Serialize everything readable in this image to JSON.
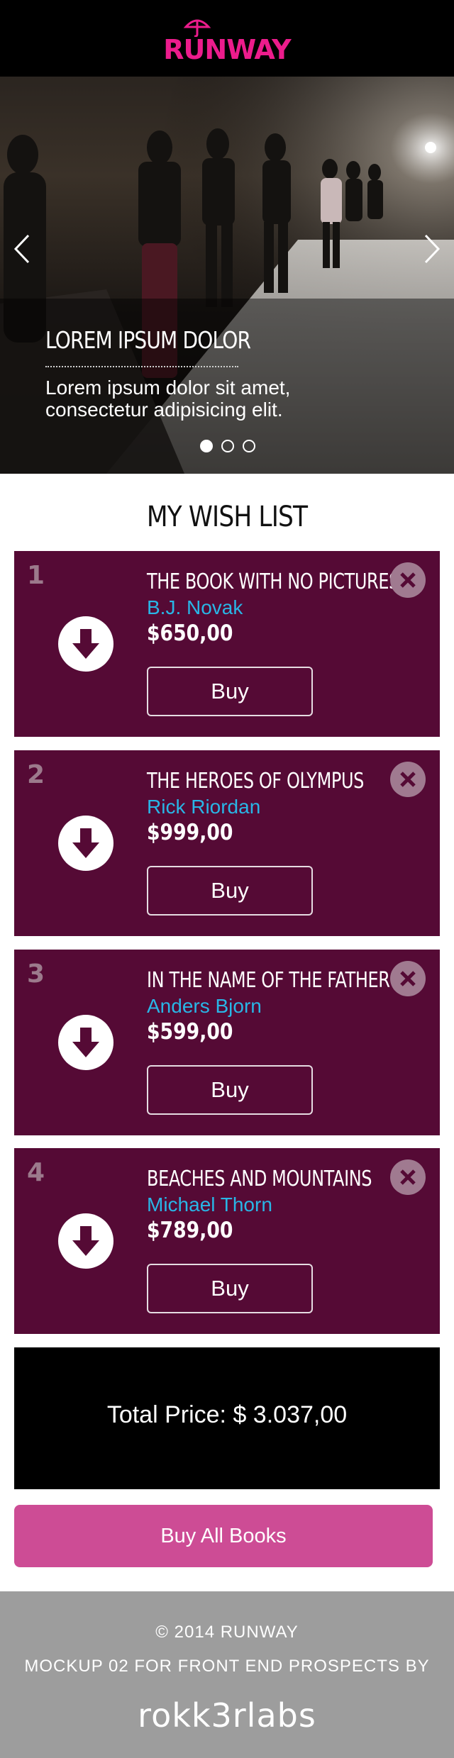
{
  "header": {
    "logo_text": "RUNWAY",
    "brand_color": "#ec1c8c"
  },
  "hero": {
    "title": "LOREM IPSUM DOLOR",
    "text": "Lorem ipsum dolor sit amet, consectetur adipisicing elit.",
    "slides_total": 3,
    "slide_active": 1
  },
  "wishlist": {
    "heading": "MY WISH LIST",
    "items": [
      {
        "number": "1",
        "title": "THE BOOK WITH NO PICTURES",
        "author": "B.J. Novak",
        "price": "$650,00",
        "buy_label": "Buy"
      },
      {
        "number": "2",
        "title": "THE HEROES OF OLYMPUS",
        "author": "Rick Riordan",
        "price": "$999,00",
        "buy_label": "Buy"
      },
      {
        "number": "3",
        "title": "IN THE NAME OF THE FATHER",
        "author": "Anders Bjorn",
        "price": "$599,00",
        "buy_label": "Buy"
      },
      {
        "number": "4",
        "title": "BEACHES AND MOUNTAINS",
        "author": "Michael Thorn",
        "price": "$789,00",
        "buy_label": "Buy"
      }
    ]
  },
  "total": {
    "label": "Total Price:  $ 3.037,00"
  },
  "buy_all_label": "Buy All Books",
  "footer": {
    "copyright": "© 2014 RUNWAY",
    "mockup": "MOCKUP 02 FOR FRONT END PROSPECTS BY",
    "brand": "rokk3rlabs"
  },
  "colors": {
    "card_bg": "#550a35",
    "author": "#29b6e6",
    "buy_all": "#cd4c95",
    "footer_bg": "#9d9d9d"
  }
}
